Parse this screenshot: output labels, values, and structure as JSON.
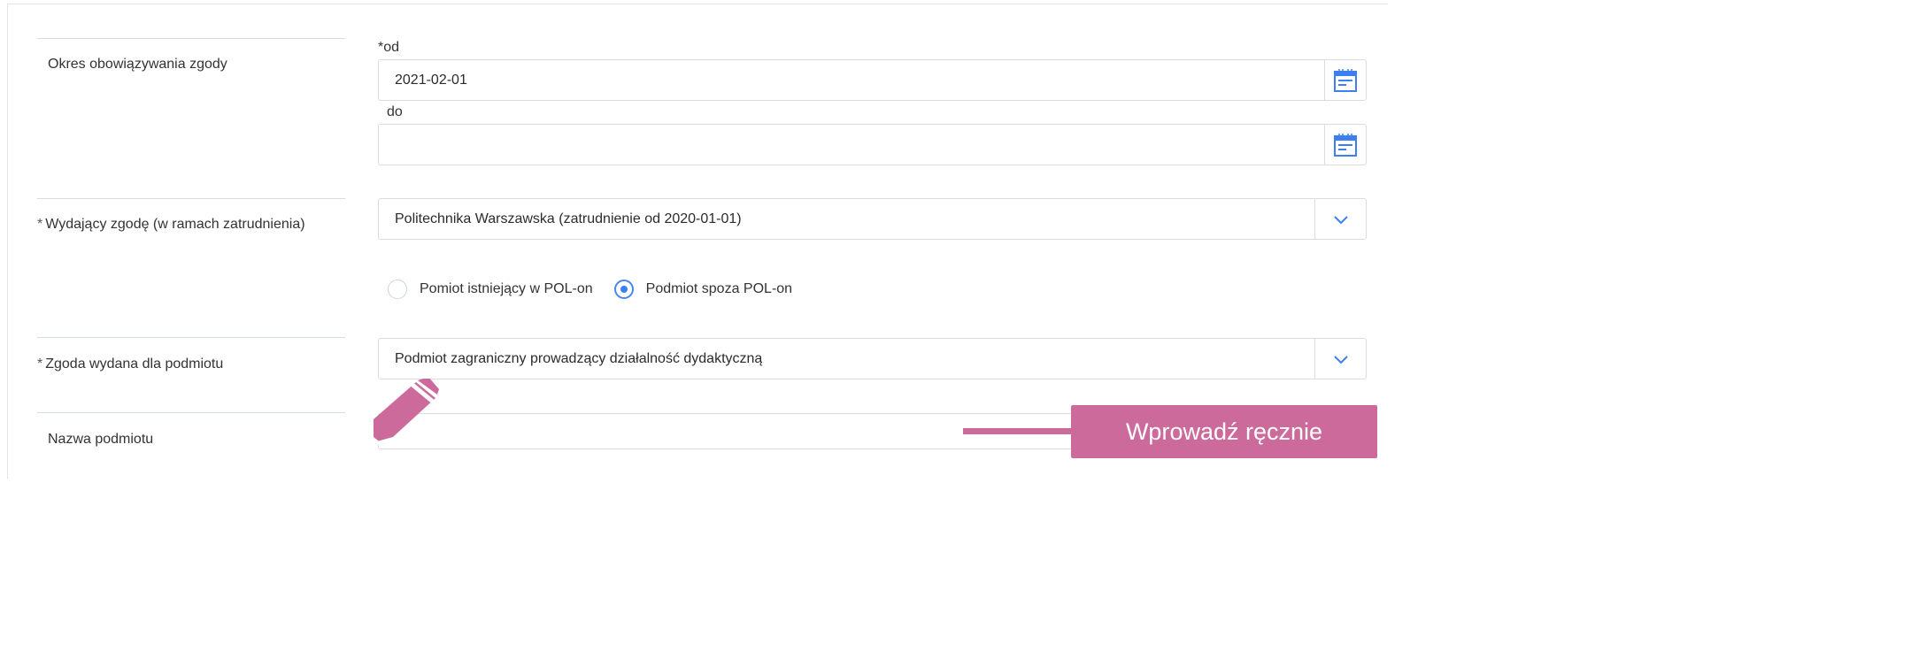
{
  "validity": {
    "label": "Okres obowiązywania zgody",
    "from_label": "*od",
    "from_value": "2021-02-01",
    "to_label": "do",
    "to_value": ""
  },
  "issuer": {
    "required_mark": "*",
    "label": "Wydający zgodę (w ramach zatrudnienia)",
    "value": "Politechnika Warszawska (zatrudnienie od 2020-01-01)"
  },
  "entity_source": {
    "options": [
      {
        "label": "Pomiot istniejący w POL-on",
        "selected": false
      },
      {
        "label": "Podmiot spoza POL-on",
        "selected": true
      }
    ]
  },
  "consent_for": {
    "required_mark": "*",
    "label": "Zgoda wydana dla podmiotu",
    "value": "Podmiot zagraniczny prowadzący działalność dydaktyczną"
  },
  "entity_name": {
    "label": "Nazwa podmiotu",
    "value": ""
  },
  "annotation": {
    "text": "Wprowadź ręcznie",
    "color": "#cc6b9b"
  },
  "icons": {
    "calendar": "calendar-icon",
    "dropdown": "chevron-down-icon",
    "pencil": "pencil-icon"
  },
  "colors": {
    "accent": "#3b7ff0",
    "border": "#d9dde3"
  }
}
